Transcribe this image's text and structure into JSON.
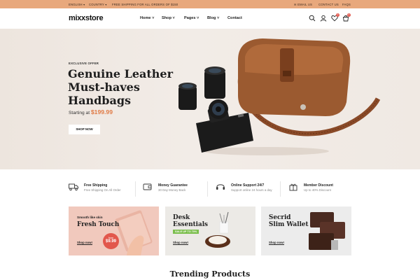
{
  "topbar": {
    "language": "ENGLISH",
    "country": "COUNTRY",
    "shipping_notice": "FREE SHIPPING FOR ALL ORDERS OF $150",
    "email": "EMAIL US",
    "contact": "CONTACT US",
    "faq": "FAQS"
  },
  "header": {
    "logo": "mixxstore",
    "nav": [
      "Home",
      "Shop",
      "Pages",
      "Blog",
      "Contact"
    ],
    "wishlist_count": "0",
    "cart_count": "0"
  },
  "hero": {
    "eyebrow": "EXCLUSIVE OFFER",
    "title_line1": "Genuine Leather",
    "title_line2": "Must-haves",
    "title_line3": "Handbags",
    "price_prefix": "Starting at",
    "price": "$199.99",
    "button": "SHOP NOW"
  },
  "features": [
    {
      "title": "Free Shipping",
      "subtitle": "Free Shipping On All Order",
      "icon": "truck-icon"
    },
    {
      "title": "Money Guarantee",
      "subtitle": "30 Day Money Back",
      "icon": "wallet-icon"
    },
    {
      "title": "Online Support 24/7",
      "subtitle": "Support online 24 hours a day",
      "icon": "headset-icon"
    },
    {
      "title": "Member Discount",
      "subtitle": "Up to 40% Discount",
      "icon": "gift-icon"
    }
  ],
  "banners": [
    {
      "small": "Smooth like skin",
      "title": "Fresh Touch",
      "price_from": "from",
      "price": "$9.99",
      "link": "Shop now!"
    },
    {
      "title_line1": "Desk",
      "title_line2": "Essentials",
      "sale": "SALE UP TO 70%",
      "link": "Shop now!"
    },
    {
      "title_line1": "Secrid",
      "title_line2": "Slim Wallet",
      "link": "Shop now!"
    }
  ],
  "section_title": "Trending Products",
  "colors": {
    "accent": "#e07a45",
    "topbar": "#e8a87c",
    "badge": "#e2574c"
  }
}
